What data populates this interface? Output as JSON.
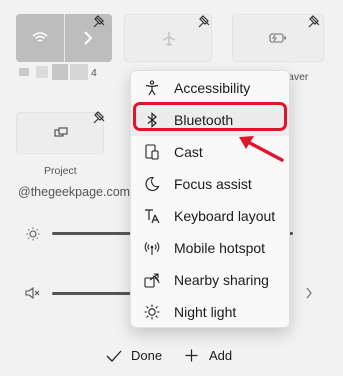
{
  "tiles": {
    "row1_blurred_label_suffix": "4",
    "row1_right_label": "aver",
    "project_label": "Project"
  },
  "watermark": "@thegeekpage.com",
  "menu": {
    "items": [
      {
        "label": "Accessibility",
        "icon": "accessibility-icon"
      },
      {
        "label": "Bluetooth",
        "icon": "bluetooth-icon"
      },
      {
        "label": "Cast",
        "icon": "cast-icon"
      },
      {
        "label": "Focus assist",
        "icon": "moon-icon"
      },
      {
        "label": "Keyboard layout",
        "icon": "keyboard-layout-icon"
      },
      {
        "label": "Mobile hotspot",
        "icon": "hotspot-icon"
      },
      {
        "label": "Nearby sharing",
        "icon": "nearby-sharing-icon"
      },
      {
        "label": "Night light",
        "icon": "night-light-icon"
      }
    ],
    "selected": "Bluetooth"
  },
  "footer": {
    "done_label": "Done",
    "add_label": "Add"
  },
  "colors": {
    "highlight": "#e0142a",
    "arrow": "#e0142a",
    "tile_active": "#bdbdbd"
  }
}
